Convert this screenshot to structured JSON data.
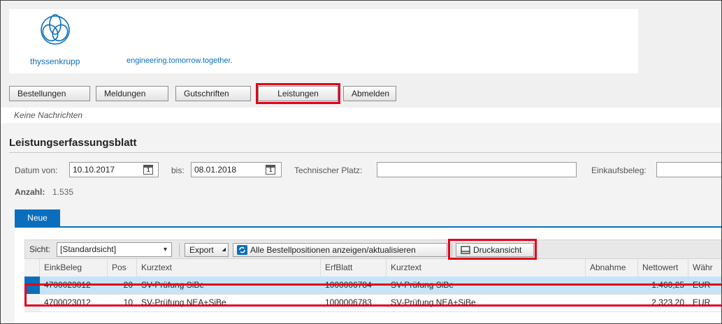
{
  "brand": {
    "name": "thyssenkrupp",
    "tagline": "engineering.tomorrow.together."
  },
  "nav": {
    "items": [
      {
        "label": "Bestellungen"
      },
      {
        "label": "Meldungen"
      },
      {
        "label": "Gutschriften"
      },
      {
        "label": "Leistungen"
      },
      {
        "label": "Abmelden"
      }
    ]
  },
  "messages": {
    "text": "Keine Nachrichten"
  },
  "page": {
    "title": "Leistungserfassungsblatt"
  },
  "filters": {
    "date_from_label": "Datum von:",
    "date_from": "10.10.2017",
    "date_to_label": "bis:",
    "date_to": "08.01.2018",
    "technical_place_label": "Technischer Platz:",
    "technical_place": "",
    "purchase_doc_label": "Einkaufsbeleg:",
    "purchase_doc": "",
    "count_label": "Anzahl:",
    "count": "1.535",
    "calendar_day": "1"
  },
  "tabs": [
    {
      "label": "Neue"
    }
  ],
  "toolbar": {
    "view_label": "Sicht:",
    "view_value": "[Standardsicht]",
    "export_label": "Export",
    "refresh_label": "Alle Bestellpositionen anzeigen/aktualisieren",
    "print_label": "Druckansicht"
  },
  "grid": {
    "columns": [
      "EinkBeleg",
      "Pos",
      "Kurztext",
      "ErfBlatt",
      "Kurztext",
      "Abnahme",
      "Nettowert",
      "Währ"
    ],
    "rows": [
      {
        "einkbeleg": "4700023012",
        "pos": "20",
        "kurztext": "SV-Prüfung SiBe",
        "erfblatt": "1000006784",
        "kurztext2": "SV-Prüfung SiBe",
        "abnahme": "",
        "nettowert": "1.460,25",
        "waehr": "EUR",
        "selected": true
      },
      {
        "einkbeleg": "4700023012",
        "pos": "10",
        "kurztext": "SV-Prüfung NEA+SiBe",
        "erfblatt": "1000006783",
        "kurztext2": "SV-Prüfung NEA+SiBe",
        "abnahme": "",
        "nettowert": "2.323,20",
        "waehr": "EUR",
        "selected": false
      }
    ]
  },
  "colors": {
    "accent": "#0a6ebd",
    "highlight": "#e0001b",
    "selected_row": "#c7e3f7"
  }
}
